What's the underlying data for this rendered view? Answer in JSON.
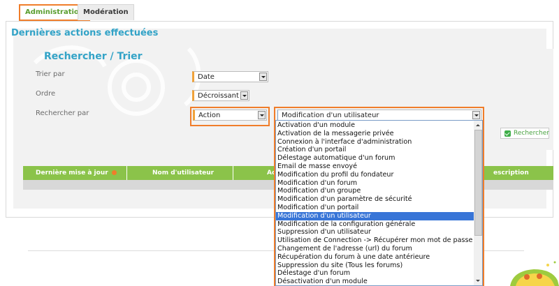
{
  "tabs": [
    {
      "label": "Administration"
    },
    {
      "label": "Modération"
    }
  ],
  "section_title": "Dernières actions effectuées",
  "search": {
    "title": "Rechercher / Trier",
    "sort_label": "Trier par",
    "sort_value": "Date",
    "order_label": "Ordre",
    "order_value": "Décroissant",
    "search_by_label": "Rechercher par",
    "search_by_value": "Action",
    "action_value": "Modification d'un utilisateur",
    "button_label": "Rechercher"
  },
  "table": {
    "columns": [
      "Dernière mise à jour",
      "Nom d'utilisateur",
      "Ac",
      "escription"
    ]
  },
  "action_options": [
    "Activation d'un module",
    "Activation de la messagerie privée",
    "Connexion à l'interface d'administration",
    "Création d'un portail",
    "Délestage automatique d'un forum",
    "Email de masse envoyé",
    "Modification du profil du fondateur",
    "Modification d'un forum",
    "Modification d'un groupe",
    "Modification d'un paramètre de sécurité",
    "Modification d'un portail",
    "Modification d'un utilisateur",
    "Modification de la configuration générale",
    "Suppression d'un utilisateur",
    "Utilisation de Connection -> Récupérer mon mot de passe",
    "Changement de l'adresse (url) du forum",
    "Récupération du forum à une date antérieure",
    "Suppression du site (Tous les forums)",
    "Délestage d'un forum",
    "Désactivation d'un module"
  ],
  "selected_option_index": 11,
  "colors": {
    "accent": "#33a3c7",
    "highlight": "#f07d2a",
    "table_header": "#8bc34a",
    "selection": "#3875d7"
  }
}
